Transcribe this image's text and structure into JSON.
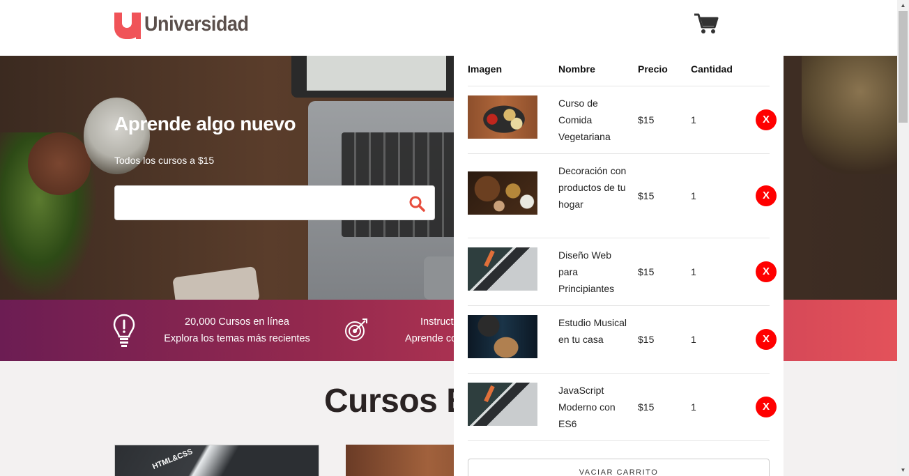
{
  "header": {
    "logo_text": "Universidad",
    "cart_icon": "shopping-cart-icon"
  },
  "hero": {
    "title": "Aprende algo nuevo",
    "subtitle": "Todos los cursos a $15",
    "search": {
      "value": "",
      "placeholder": "",
      "icon": "search-icon"
    }
  },
  "features": [
    {
      "icon": "lightbulb-icon",
      "line1": "20,000 Cursos en línea",
      "line2": "Explora los temas más recientes"
    },
    {
      "icon": "target-icon",
      "line1": "Instruct",
      "line2": "Aprende co"
    }
  ],
  "section": {
    "title": "Cursos E"
  },
  "cards": [
    {
      "badge": "HTML&CSS"
    },
    {
      "badge": ""
    }
  ],
  "cart": {
    "headers": {
      "image": "Imagen",
      "name": "Nombre",
      "price": "Precio",
      "quantity": "Cantidad"
    },
    "items": [
      {
        "name": "Curso de Comida Vegetariana",
        "price": "$15",
        "quantity": "1",
        "remove": "X"
      },
      {
        "name": "Decoración con productos de tu hogar",
        "price": "$15",
        "quantity": "1",
        "remove": "X"
      },
      {
        "name": "Diseño Web para Principiantes",
        "price": "$15",
        "quantity": "1",
        "remove": "X"
      },
      {
        "name": "Estudio Musical en tu casa",
        "price": "$15",
        "quantity": "1",
        "remove": "X"
      },
      {
        "name": "JavaScript Moderno con ES6",
        "price": "$15",
        "quantity": "1",
        "remove": "X"
      }
    ],
    "empty_button": "VACIAR CARRITO"
  },
  "colors": {
    "brand": "#f05358",
    "logo_text": "#5a4f4b",
    "remove_button": "#ff0000",
    "bar_start": "#6c1d53",
    "bar_end": "#e3525a"
  }
}
